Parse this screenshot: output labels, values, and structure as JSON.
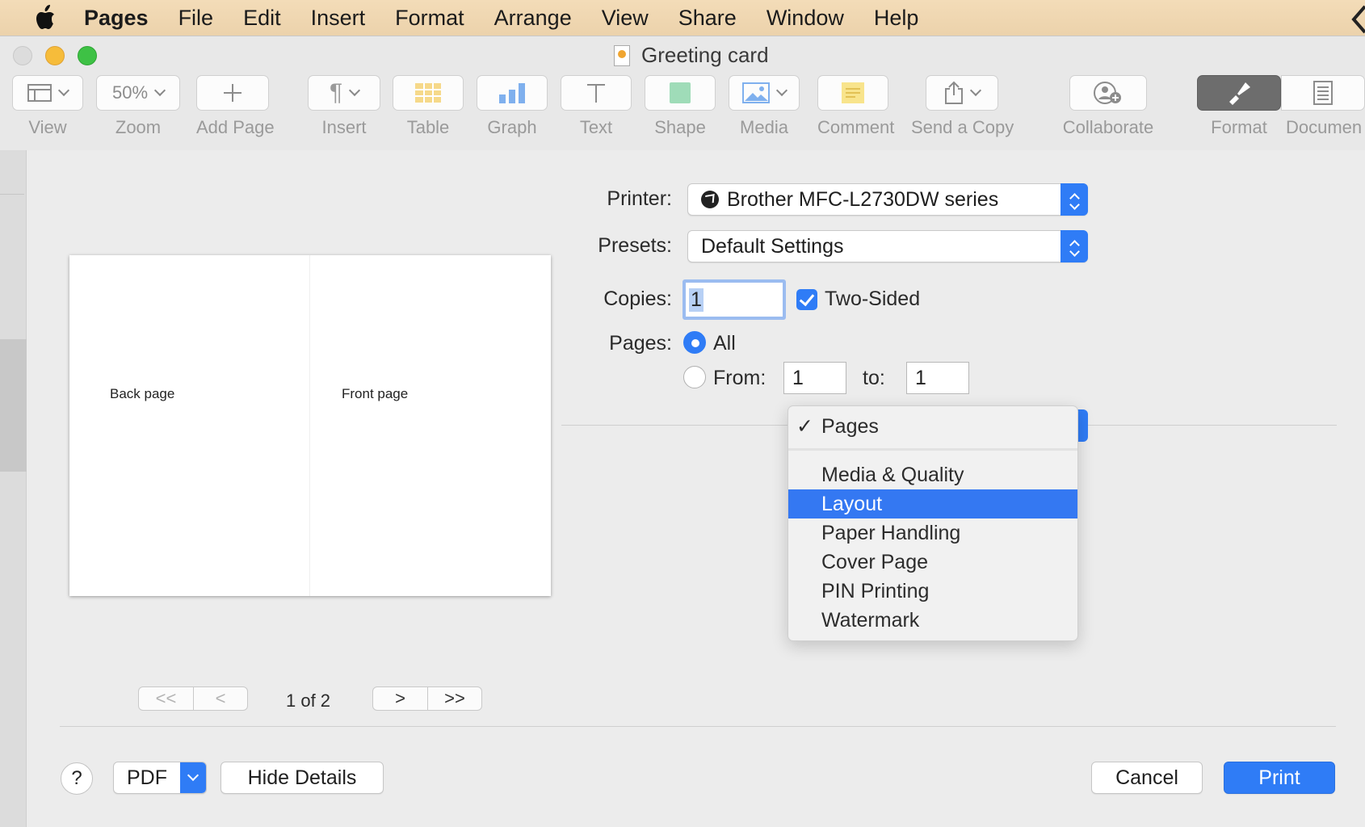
{
  "menubar": {
    "items": [
      "Pages",
      "File",
      "Edit",
      "Insert",
      "Format",
      "Arrange",
      "View",
      "Share",
      "Window",
      "Help"
    ]
  },
  "window": {
    "title": "Greeting card"
  },
  "toolbar": {
    "view": "View",
    "zoom_value": "50%",
    "zoom": "Zoom",
    "add_page": "Add Page",
    "insert": "Insert",
    "table": "Table",
    "graph": "Graph",
    "text": "Text",
    "shape": "Shape",
    "media": "Media",
    "comment": "Comment",
    "send_copy": "Send a Copy",
    "collaborate": "Collaborate",
    "format": "Format",
    "document": "Documen"
  },
  "preview": {
    "back_page": "Back page",
    "front_page": "Front page",
    "page_indicator": "1 of 2",
    "first": "<<",
    "prev": "<",
    "next": ">",
    "last": ">>"
  },
  "form": {
    "printer_label": "Printer:",
    "printer_value": "Brother MFC-L2730DW series",
    "presets_label": "Presets:",
    "presets_value": "Default Settings",
    "copies_label": "Copies:",
    "copies_value": "1",
    "two_sided_label": "Two-Sided",
    "pages_label": "Pages:",
    "all_label": "All",
    "from_label": "From:",
    "from_value": "1",
    "to_label": "to:",
    "to_value": "1"
  },
  "dropdown": {
    "checked": "Pages",
    "items": [
      "Media & Quality",
      "Layout",
      "Paper Handling",
      "Cover Page",
      "PIN Printing",
      "Watermark"
    ],
    "highlighted": "Layout"
  },
  "buttons": {
    "help": "?",
    "pdf": "PDF",
    "hide_details": "Hide Details",
    "cancel": "Cancel",
    "print": "Print"
  },
  "colors": {
    "accent": "#2f7cf6",
    "menubar_bg": "#f0d8b2"
  }
}
